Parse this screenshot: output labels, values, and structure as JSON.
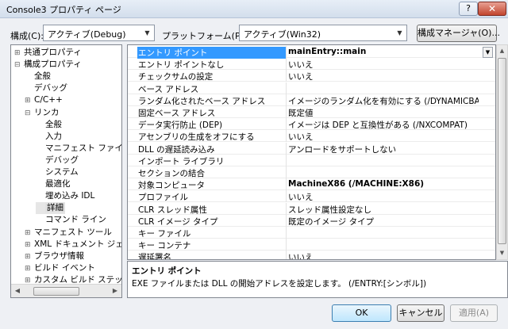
{
  "window": {
    "title": "Console3 プロパティ ページ",
    "help_label": "?",
    "close_label": "✕"
  },
  "toolbar": {
    "configuration_label": "構成(C):",
    "configuration_value": "アクティブ(Debug)",
    "platform_label": "プラットフォーム(P):",
    "platform_value": "アクティブ(Win32)",
    "config_manager_label": "構成マネージャ(O)..."
  },
  "tree": {
    "items": [
      {
        "label": "共通プロパティ",
        "expander": "⊞",
        "level": 0
      },
      {
        "label": "構成プロパティ",
        "expander": "⊟",
        "level": 0
      },
      {
        "label": "全般",
        "expander": "",
        "level": 1
      },
      {
        "label": "デバッグ",
        "expander": "",
        "level": 1
      },
      {
        "label": "C/C++",
        "expander": "⊞",
        "level": 1
      },
      {
        "label": "リンカ",
        "expander": "⊟",
        "level": 1
      },
      {
        "label": "全般",
        "expander": "",
        "level": 2
      },
      {
        "label": "入力",
        "expander": "",
        "level": 2
      },
      {
        "label": "マニフェスト ファイル",
        "expander": "",
        "level": 2
      },
      {
        "label": "デバッグ",
        "expander": "",
        "level": 2
      },
      {
        "label": "システム",
        "expander": "",
        "level": 2
      },
      {
        "label": "最適化",
        "expander": "",
        "level": 2
      },
      {
        "label": "埋め込み IDL",
        "expander": "",
        "level": 2
      },
      {
        "label": "詳細",
        "expander": "",
        "level": 2,
        "selected": true
      },
      {
        "label": "コマンド ライン",
        "expander": "",
        "level": 2
      },
      {
        "label": "マニフェスト ツール",
        "expander": "⊞",
        "level": 1
      },
      {
        "label": "XML ドキュメント ジェネ",
        "expander": "⊞",
        "level": 1
      },
      {
        "label": "ブラウザ情報",
        "expander": "⊞",
        "level": 1
      },
      {
        "label": "ビルド イベント",
        "expander": "⊞",
        "level": 1
      },
      {
        "label": "カスタム ビルド ステップ",
        "expander": "⊞",
        "level": 1
      }
    ]
  },
  "properties": {
    "rows": [
      {
        "name": "エントリ ポイント",
        "value": "mainEntry::main",
        "selected": true,
        "bold": true
      },
      {
        "name": "エントリ ポイントなし",
        "value": "いいえ"
      },
      {
        "name": "チェックサムの設定",
        "value": "いいえ"
      },
      {
        "name": "ベース アドレス",
        "value": ""
      },
      {
        "name": "ランダム化されたベース アドレス",
        "value": "イメージのランダム化を有効にする (/DYNAMICBASE)"
      },
      {
        "name": "固定ベース アドレス",
        "value": "既定値"
      },
      {
        "name": "データ実行防止 (DEP)",
        "value": "イメージは DEP と互換性がある (/NXCOMPAT)"
      },
      {
        "name": "アセンブリの生成をオフにする",
        "value": "いいえ"
      },
      {
        "name": "DLL の遅延読み込み",
        "value": "アンロードをサポートしない"
      },
      {
        "name": "インポート ライブラリ",
        "value": ""
      },
      {
        "name": "セクションの結合",
        "value": ""
      },
      {
        "name": "対象コンピュータ",
        "value": "MachineX86 (/MACHINE:X86)",
        "bold": true
      },
      {
        "name": "プロファイル",
        "value": "いいえ"
      },
      {
        "name": "CLR スレッド属性",
        "value": "スレッド属性設定なし"
      },
      {
        "name": "CLR イメージ タイプ",
        "value": "既定のイメージ タイプ"
      },
      {
        "name": "キー ファイル",
        "value": ""
      },
      {
        "name": "キー コンテナ",
        "value": ""
      },
      {
        "name": "遅延署名",
        "value": "いいえ"
      }
    ]
  },
  "description": {
    "title": "エントリ ポイント",
    "text": "EXE ファイルまたは DLL の開始アドレスを設定します。   (/ENTRY:[シンボル])"
  },
  "buttons": {
    "ok": "OK",
    "cancel": "キャンセル",
    "apply": "適用(A)"
  }
}
